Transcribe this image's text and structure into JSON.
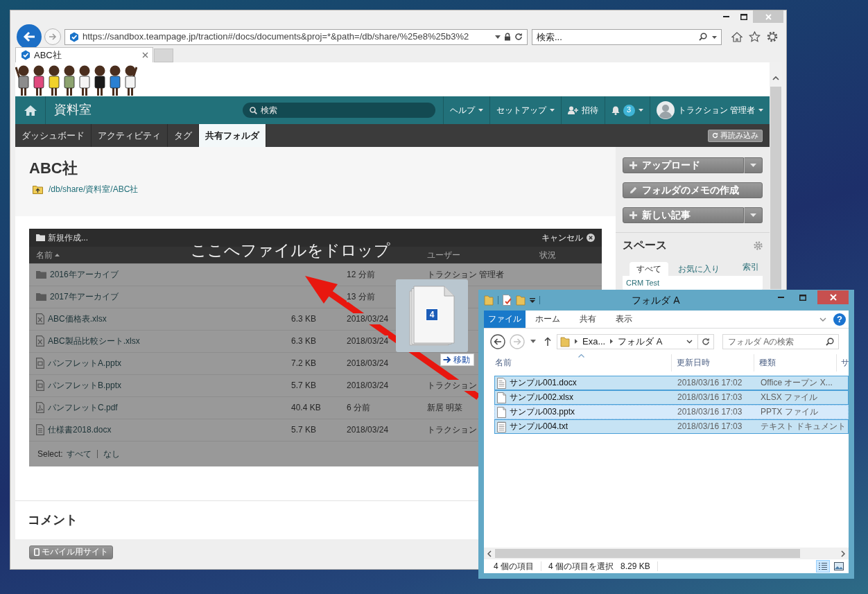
{
  "browser": {
    "url": "https://sandbox.teampage.jp/traction#/docs/documents&proj=*&path=/db/share/%25e8%25b3%2",
    "search": {
      "placeholder": "検索..."
    },
    "tabs": [
      {
        "label": "ABC社",
        "selected": true
      }
    ]
  },
  "nav": {
    "title": "資料室",
    "search": {
      "placeholder": "検索"
    },
    "items": [
      {
        "kind": "menu",
        "label": "ヘルプ"
      },
      {
        "kind": "menu",
        "label": "セットアップ"
      },
      {
        "kind": "invite",
        "label": "招待"
      },
      {
        "kind": "notifications",
        "count": "3"
      },
      {
        "kind": "user",
        "label": "トラクション 管理者"
      }
    ]
  },
  "tabs": [
    {
      "label": "ダッシュボード",
      "selected": false
    },
    {
      "label": "アクティビティ",
      "selected": false
    },
    {
      "label": "タグ",
      "selected": false
    },
    {
      "label": "共有フォルダ",
      "selected": true
    }
  ],
  "reload_button": "再読み込み",
  "page": {
    "title": "ABC社",
    "path": "/db/share/資料室/ABC社"
  },
  "files": {
    "new_label": "新規作成...",
    "cancel_label": "キャンセル",
    "drop_message": "ここへファイルをドロップ",
    "columns": {
      "name": {
        "label": "名前",
        "sorted": true
      },
      "user": {
        "label": "ユーザー",
        "sorted": false
      },
      "status": {
        "label": "状況",
        "sorted": false
      }
    },
    "rows": [
      {
        "kind": "folder",
        "name": "2016年アーカイブ",
        "date": "12 分前",
        "user": "トラクション 管理者"
      },
      {
        "kind": "folder",
        "name": "2017年アーカイブ",
        "date": "13 分前"
      },
      {
        "kind": "spreadsheet",
        "name": "ABC価格表.xlsx",
        "size": "6.3 KB",
        "date": "2018/03/24"
      },
      {
        "kind": "spreadsheet",
        "name": "ABC製品比較シート.xlsx",
        "size": "6.3 KB",
        "date": "2018/03/24"
      },
      {
        "kind": "slides",
        "name": "パンフレットA.pptx",
        "size": "7.2 KB",
        "date": "2018/03/24"
      },
      {
        "kind": "slides",
        "name": "パンフレットB.pptx",
        "size": "5.7 KB",
        "date": "2018/03/24",
        "user": "トラクション"
      },
      {
        "kind": "pdf",
        "name": "パンフレットC.pdf",
        "size": "40.4 KB",
        "date": "6 分前",
        "user": "新居 明菜"
      },
      {
        "kind": "document",
        "name": "仕様書2018.docx",
        "size": "5.7 KB",
        "date": "2018/03/24",
        "user": "トラクション"
      }
    ],
    "select": {
      "label": "Select:",
      "all": "すべて",
      "none": "なし"
    }
  },
  "comments": {
    "title": "コメント"
  },
  "footer": {
    "mobile_button": "モバイル用サイト"
  },
  "sidebar": {
    "actions": [
      {
        "kind": "menu",
        "label": "アップロード"
      },
      {
        "kind": "edit",
        "label": "フォルダのメモの作成"
      },
      {
        "kind": "menu",
        "label": "新しい記事"
      }
    ],
    "spaces": {
      "title": "スペース",
      "tabs": [
        {
          "label": "すべて",
          "selected": true
        },
        {
          "label": "お気に入り",
          "selected": false
        }
      ],
      "index_link": "索引",
      "items": [
        "CRM Test"
      ]
    }
  },
  "drag": {
    "count": "4",
    "action": "移動"
  },
  "explorer": {
    "title": "フォルダ A",
    "ribbon_tabs": [
      {
        "label": "ファイル",
        "selected": true
      },
      {
        "label": "ホーム",
        "selected": false
      },
      {
        "label": "共有",
        "selected": false
      },
      {
        "label": "表示",
        "selected": false
      }
    ],
    "help_label": "?",
    "address": [
      "Exa...",
      "フォルダ A"
    ],
    "search": {
      "placeholder": "フォルダ Aの検索"
    },
    "columns": [
      {
        "label": "名前",
        "sorted": true
      },
      {
        "label": "更新日時",
        "sorted": false
      },
      {
        "label": "種類",
        "sorted": false
      },
      {
        "label": "サ",
        "sorted": false
      }
    ],
    "rows": [
      {
        "kind": "document",
        "name": "サンプル001.docx",
        "date": "2018/03/16 17:02",
        "type": "Office オープン X...",
        "selected": true,
        "focused": false
      },
      {
        "kind": "blank",
        "name": "サンプル002.xlsx",
        "date": "2018/03/16 17:03",
        "type": "XLSX ファイル",
        "selected": true,
        "focused": false
      },
      {
        "kind": "blank",
        "name": "サンプル003.pptx",
        "date": "2018/03/16 17:03",
        "type": "PPTX ファイル",
        "selected": true,
        "focused": true
      },
      {
        "kind": "text",
        "name": "サンプル004.txt",
        "date": "2018/03/16 17:03",
        "type": "テキスト ドキュメント",
        "selected": true,
        "focused": false
      }
    ],
    "status": {
      "count": "4 個の項目",
      "selection": "4 個の項目を選択",
      "size": "8.29 KB"
    },
    "views": [
      {
        "kind": "details",
        "selected": true
      },
      {
        "kind": "thumbnails",
        "selected": false
      }
    ]
  }
}
